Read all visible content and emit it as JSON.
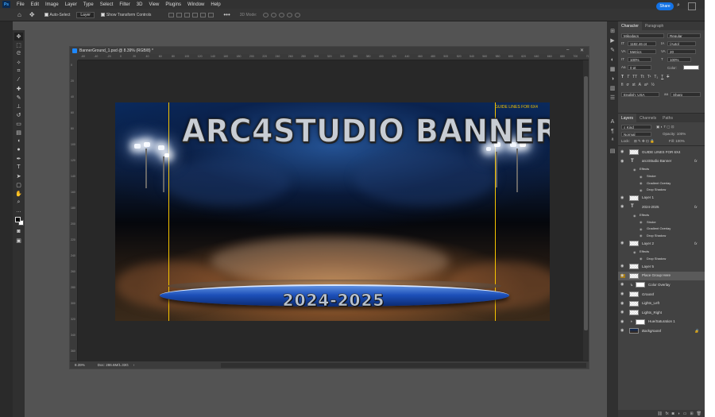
{
  "menubar": {
    "logo": "Ps",
    "items": [
      "File",
      "Edit",
      "Image",
      "Layer",
      "Type",
      "Select",
      "Filter",
      "3D",
      "View",
      "Plugins",
      "Window",
      "Help"
    ]
  },
  "options": {
    "auto_select_label": "Auto-Select",
    "auto_select_target": "Layer",
    "show_transform_label": "Show Transform Controls",
    "mode_3d": "3D Mode:",
    "share_label": "Share"
  },
  "document": {
    "title": "BannerGround_1.psd @ 8.39% (RGB/8) *",
    "zoom": "8.39%",
    "doc_size": "Doc: 286.6M/1.33G",
    "ruler_h": [
      "-60",
      "-40",
      "-20",
      "0",
      "20",
      "40",
      "60",
      "80",
      "100",
      "120",
      "140",
      "160",
      "180",
      "200",
      "220",
      "240",
      "260",
      "280",
      "300",
      "320",
      "340",
      "360",
      "380",
      "400",
      "420",
      "440",
      "460",
      "480",
      "500",
      "520",
      "540",
      "560",
      "580",
      "600",
      "620",
      "640",
      "660",
      "680",
      "700",
      "720"
    ],
    "ruler_v": [
      "0",
      "20",
      "40",
      "60",
      "80",
      "100",
      "120",
      "140",
      "160",
      "180",
      "200",
      "220",
      "240",
      "260",
      "280",
      "300",
      "320",
      "340",
      "360"
    ]
  },
  "canvas": {
    "banner_title": "ARC4STUDIO BANNER",
    "year_text": "2024-2025",
    "guide_label": "GUIDE LINES FOR 6X4"
  },
  "character": {
    "tabs": [
      "Character",
      "Paragraph"
    ],
    "font_family": "Mikodacs",
    "font_style": "Regular",
    "size": "1182.46 pt",
    "leading": "(Auto)",
    "kerning": "Metrics",
    "tracking": "20",
    "baseline": "0 pt",
    "vscale": "100%",
    "hscale": "100%",
    "color_label": "Color:",
    "language": "English: USA",
    "aa": "Sharp",
    "tt_buttons": [
      "T",
      "T",
      "TT",
      "Tt",
      "T¹",
      "T₁",
      "T",
      "T"
    ]
  },
  "layers": {
    "tabs": [
      "Layers",
      "Channels",
      "Paths"
    ],
    "filter_kind": "Kind",
    "blend_mode": "Normal",
    "opacity": "Opacity: 100%",
    "lock_label": "Lock:",
    "fill": "Fill: 100%",
    "rows": [
      {
        "name": "GUIDE LINES FOR 6X4",
        "kind": "layer",
        "fx": ""
      },
      {
        "name": "arc4Studio Banner",
        "kind": "text",
        "fx": "fx"
      },
      {
        "name": "Effects",
        "kind": "sub"
      },
      {
        "name": "Stroke",
        "kind": "subsub"
      },
      {
        "name": "Gradient Overlay",
        "kind": "subsub"
      },
      {
        "name": "Drop Shadow",
        "kind": "subsub"
      },
      {
        "name": "Layer 1",
        "kind": "layer",
        "fx": ""
      },
      {
        "name": "2024-2025",
        "kind": "text",
        "fx": "fx"
      },
      {
        "name": "Effects",
        "kind": "sub"
      },
      {
        "name": "Stroke",
        "kind": "subsub"
      },
      {
        "name": "Gradient Overlay",
        "kind": "subsub"
      },
      {
        "name": "Drop Shadow",
        "kind": "subsub"
      },
      {
        "name": "Layer 2",
        "kind": "layer",
        "fx": "fx"
      },
      {
        "name": "Effects",
        "kind": "sub"
      },
      {
        "name": "Drop Shadow",
        "kind": "subsub"
      },
      {
        "name": "Layer 5",
        "kind": "layer",
        "fx": ""
      },
      {
        "name": "Place Group Here",
        "kind": "layer",
        "fx": ""
      },
      {
        "name": "Color Overlay",
        "kind": "clip",
        "fx": ""
      },
      {
        "name": "Ground",
        "kind": "layer",
        "fx": ""
      },
      {
        "name": "Lights_Left",
        "kind": "layer",
        "fx": ""
      },
      {
        "name": "Lights_Right",
        "kind": "layer",
        "fx": ""
      },
      {
        "name": "Hue/Saturation 1",
        "kind": "adjust",
        "fx": ""
      },
      {
        "name": "Background",
        "kind": "bg",
        "fx": ""
      }
    ]
  },
  "colors": {
    "accent": "#1473e6",
    "guide": "#f6c400",
    "highlight": "#a57b17"
  }
}
